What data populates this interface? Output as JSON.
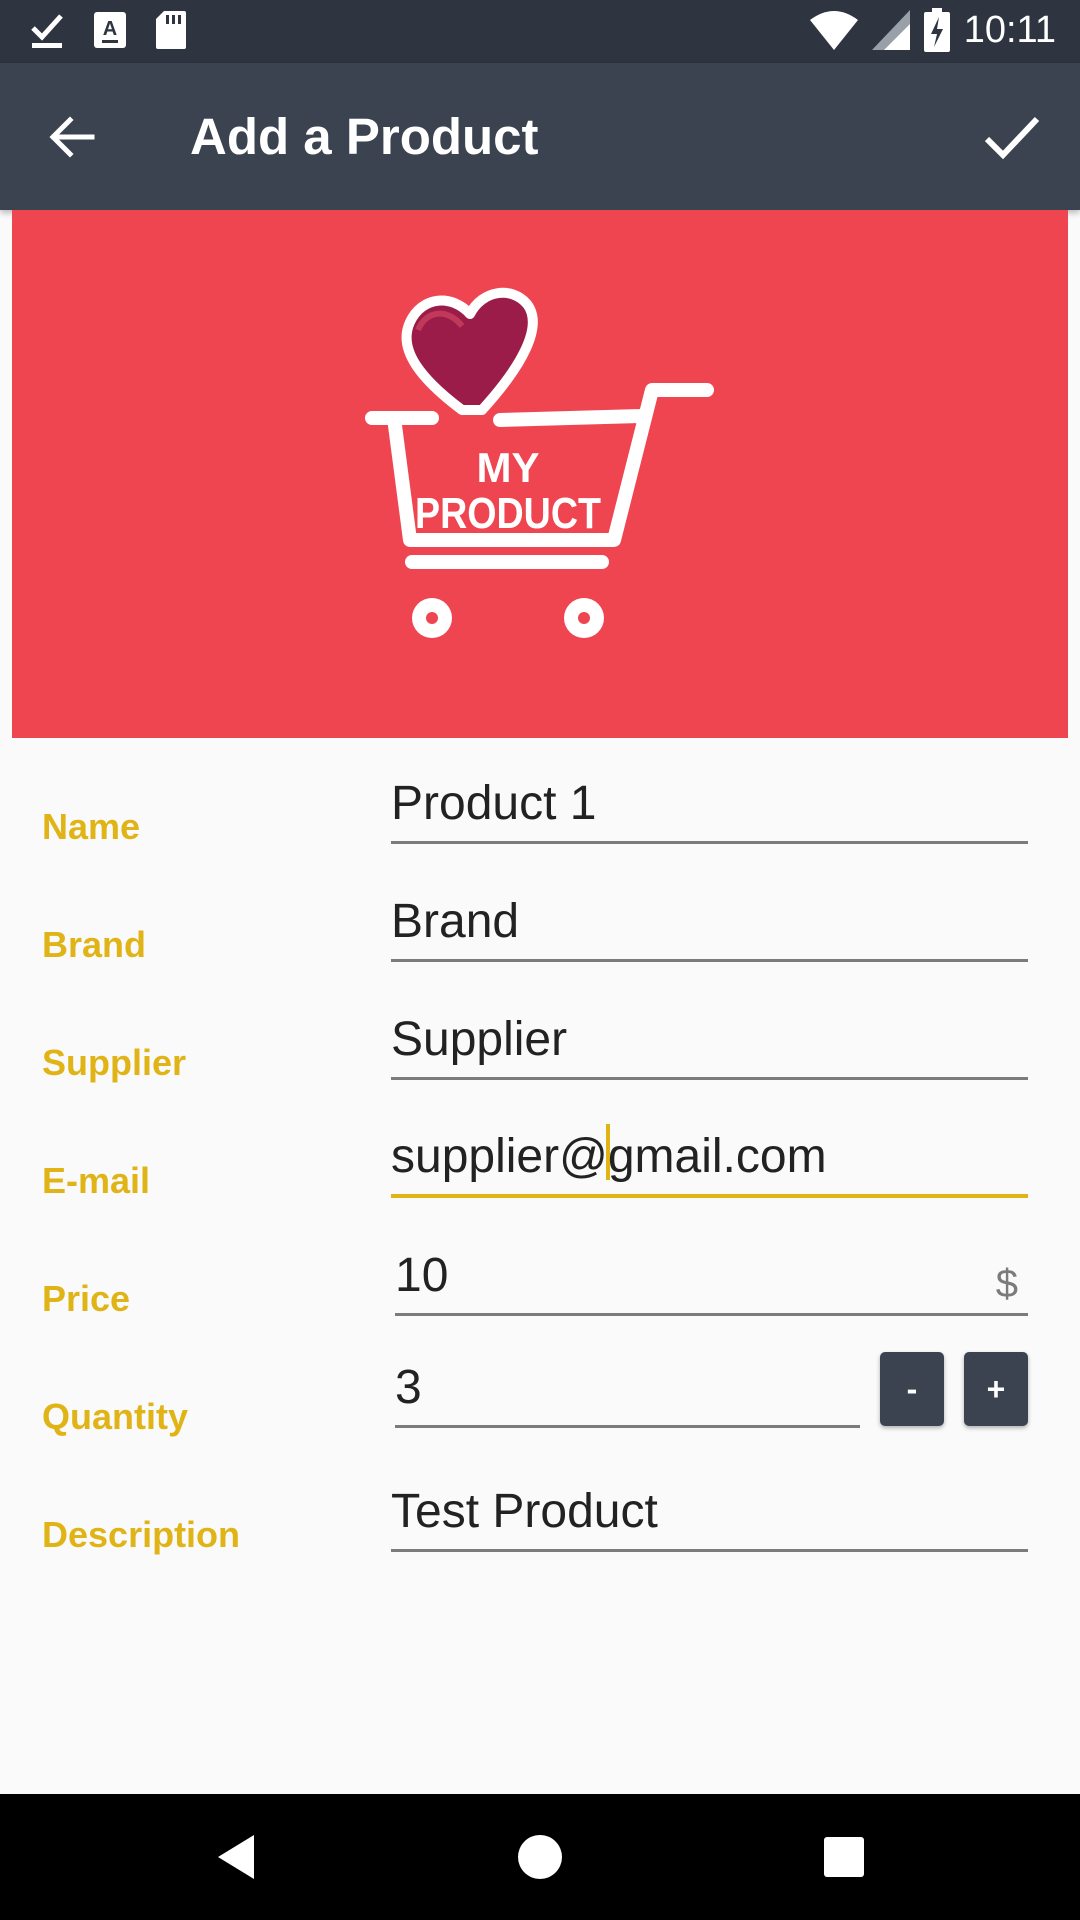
{
  "status_bar": {
    "time": "10:11",
    "icons_left": [
      "download-done-icon",
      "text-a-icon",
      "sd-card-icon"
    ],
    "icons_right": [
      "wifi-icon",
      "signal-icon",
      "battery-charging-icon"
    ]
  },
  "app_bar": {
    "title": "Add a Product",
    "back_icon": "arrow-back-icon",
    "done_icon": "check-icon"
  },
  "banner": {
    "logo_text_line1": "MY",
    "logo_text_line2": "PRODUCT",
    "background_color": "#ef4551",
    "heart_color": "#9b1c48"
  },
  "form": {
    "name_label": "Name",
    "name_value": "Product 1",
    "brand_label": "Brand",
    "brand_value": "Brand",
    "supplier_label": "Supplier",
    "supplier_value": "Supplier",
    "email_label": "E-mail",
    "email_value_before_caret": "supplier@",
    "email_value_after_caret": "gmail.com",
    "price_label": "Price",
    "price_value": "10",
    "price_unit": "$",
    "quantity_label": "Quantity",
    "quantity_value": "3",
    "decrement_label": "-",
    "increment_label": "+",
    "description_label": "Description",
    "description_value": "Test Product"
  },
  "colors": {
    "accent": "#e0b416",
    "app_bar": "#3b4350",
    "status_bar": "#2e3440"
  },
  "nav_bar": {
    "icons": [
      "nav-back-icon",
      "nav-home-icon",
      "nav-recents-icon"
    ]
  }
}
